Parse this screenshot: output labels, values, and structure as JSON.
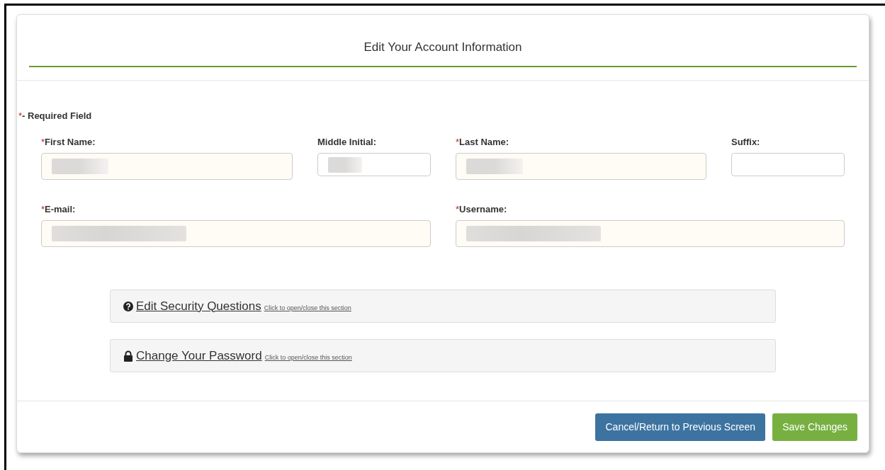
{
  "title": "Edit Your Account Information",
  "required_note": {
    "marker": "*",
    "text": "- Required Field"
  },
  "fields": [
    {
      "label": "First Name:",
      "required": true,
      "value_hidden": true
    },
    {
      "label": "Middle Initial:",
      "required": false,
      "value_hidden": true
    },
    {
      "label": "Last Name:",
      "required": true,
      "value_hidden": true
    },
    {
      "label": "Suffix:",
      "required": false,
      "value_hidden": false
    },
    {
      "label": "E-mail:",
      "required": true,
      "value_hidden": true
    },
    {
      "label": "Username:",
      "required": true,
      "value_hidden": true
    }
  ],
  "sections": [
    {
      "title": "Edit Security Questions",
      "hint": "Click to open/close this section"
    },
    {
      "title": "Change Your Password",
      "hint": "Click to open/close this section"
    }
  ],
  "buttons": [
    {
      "label": "Cancel/Return to Previous Screen",
      "kind": "secondary"
    },
    {
      "label": "Save Changes",
      "kind": "primary"
    }
  ]
}
